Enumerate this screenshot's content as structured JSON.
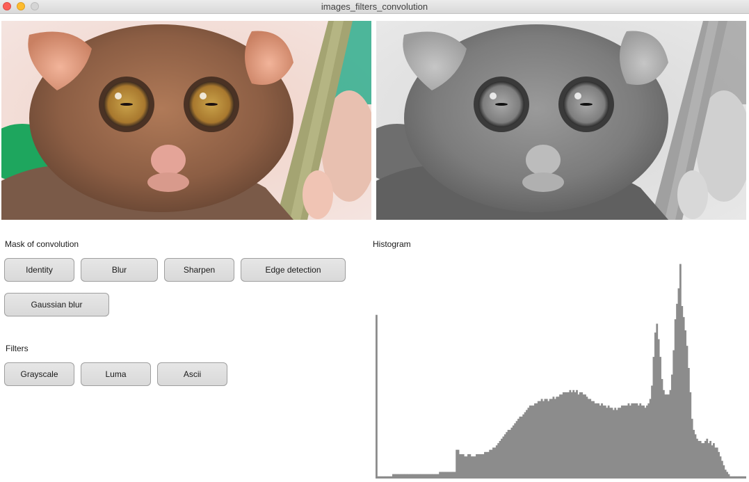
{
  "window": {
    "title": "images_filters_convolution"
  },
  "images": {
    "original": "tarsier-photo-color",
    "filtered": "tarsier-photo-grayscale"
  },
  "mask_section": {
    "label": "Mask of convolution",
    "buttons": [
      {
        "id": "identity",
        "label": "Identity"
      },
      {
        "id": "blur",
        "label": "Blur"
      },
      {
        "id": "sharpen",
        "label": "Sharpen"
      },
      {
        "id": "edge",
        "label": "Edge detection"
      },
      {
        "id": "gaussian",
        "label": "Gaussian blur"
      }
    ]
  },
  "filters_section": {
    "label": "Filters",
    "buttons": [
      {
        "id": "grayscale",
        "label": "Grayscale"
      },
      {
        "id": "luma",
        "label": "Luma"
      },
      {
        "id": "ascii",
        "label": "Ascii"
      }
    ]
  },
  "histogram": {
    "label": "Histogram",
    "bar_color": "#8c8c8c",
    "bins": 256,
    "relative_heights": [
      0.74,
      0.01,
      0.01,
      0.01,
      0.01,
      0.01,
      0.01,
      0.01,
      0.01,
      0.01,
      0.02,
      0.02,
      0.02,
      0.02,
      0.02,
      0.02,
      0.02,
      0.02,
      0.02,
      0.02,
      0.02,
      0.02,
      0.02,
      0.02,
      0.02,
      0.02,
      0.02,
      0.02,
      0.02,
      0.02,
      0.02,
      0.02,
      0.02,
      0.02,
      0.02,
      0.02,
      0.02,
      0.02,
      0.03,
      0.03,
      0.03,
      0.03,
      0.03,
      0.03,
      0.03,
      0.03,
      0.03,
      0.03,
      0.13,
      0.13,
      0.11,
      0.11,
      0.11,
      0.1,
      0.1,
      0.11,
      0.11,
      0.1,
      0.1,
      0.1,
      0.11,
      0.11,
      0.11,
      0.11,
      0.11,
      0.12,
      0.12,
      0.12,
      0.13,
      0.13,
      0.14,
      0.14,
      0.15,
      0.16,
      0.17,
      0.18,
      0.19,
      0.2,
      0.21,
      0.22,
      0.22,
      0.23,
      0.24,
      0.25,
      0.26,
      0.27,
      0.28,
      0.28,
      0.29,
      0.3,
      0.31,
      0.32,
      0.33,
      0.33,
      0.33,
      0.34,
      0.34,
      0.35,
      0.35,
      0.36,
      0.35,
      0.36,
      0.36,
      0.35,
      0.36,
      0.36,
      0.37,
      0.36,
      0.37,
      0.37,
      0.38,
      0.38,
      0.39,
      0.39,
      0.39,
      0.39,
      0.4,
      0.39,
      0.4,
      0.39,
      0.4,
      0.38,
      0.39,
      0.39,
      0.38,
      0.38,
      0.37,
      0.36,
      0.36,
      0.35,
      0.35,
      0.34,
      0.34,
      0.34,
      0.33,
      0.34,
      0.33,
      0.33,
      0.32,
      0.33,
      0.32,
      0.32,
      0.31,
      0.32,
      0.31,
      0.32,
      0.32,
      0.33,
      0.33,
      0.33,
      0.33,
      0.34,
      0.33,
      0.34,
      0.34,
      0.34,
      0.34,
      0.33,
      0.34,
      0.33,
      0.33,
      0.32,
      0.33,
      0.34,
      0.36,
      0.42,
      0.55,
      0.66,
      0.7,
      0.63,
      0.55,
      0.45,
      0.4,
      0.38,
      0.38,
      0.38,
      0.4,
      0.47,
      0.58,
      0.72,
      0.79,
      0.86,
      0.97,
      0.78,
      0.73,
      0.67,
      0.6,
      0.5,
      0.39,
      0.27,
      0.22,
      0.2,
      0.18,
      0.17,
      0.17,
      0.16,
      0.16,
      0.17,
      0.18,
      0.16,
      0.17,
      0.15,
      0.16,
      0.14,
      0.14,
      0.12,
      0.1,
      0.08,
      0.06,
      0.04,
      0.03,
      0.02,
      0.01,
      0.01,
      0.01,
      0.01,
      0.01,
      0.01,
      0.01,
      0.01,
      0.01,
      0.01
    ]
  }
}
